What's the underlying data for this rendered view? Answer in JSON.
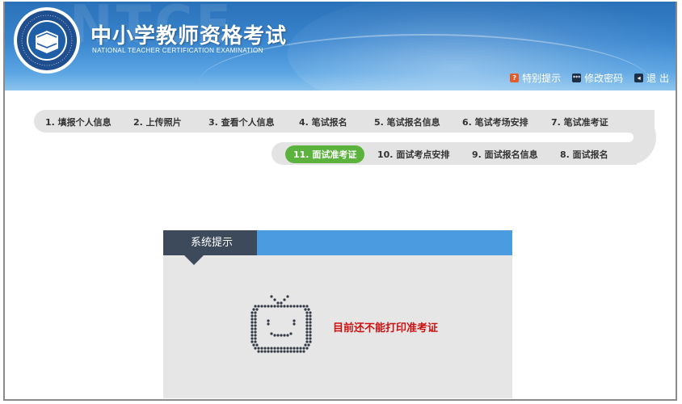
{
  "header": {
    "title": "中小学教师资格考试",
    "subtitle": "NATIONAL TEACHER CERTIFICATION EXAMINATION",
    "watermark": "NTCE",
    "links": [
      {
        "label": "特别提示",
        "icon": "help-icon"
      },
      {
        "label": "修改密码",
        "icon": "password-icon"
      },
      {
        "label": "退 出",
        "icon": "exit-icon"
      }
    ]
  },
  "steps_row1": [
    "1. 填报个人信息",
    "2. 上传照片",
    "3. 查看个人信息",
    "4. 笔试报名",
    "5. 笔试报名信息",
    "6. 笔试考场安排",
    "7. 笔试准考证"
  ],
  "steps_row2": [
    "11. 面试准考证",
    "10. 面试考点安排",
    "9. 面试报名信息",
    "8. 面试报名"
  ],
  "active_step": "11. 面试准考证",
  "panel": {
    "tab_label": "系统提示",
    "message": "目前还不能打印准考证"
  },
  "colors": {
    "header_blue": "#2a71b8",
    "active_green": "#5bb23d",
    "panel_blue": "#4a9be0",
    "panel_dark": "#3d4a5c",
    "message_red": "#cc1111"
  }
}
